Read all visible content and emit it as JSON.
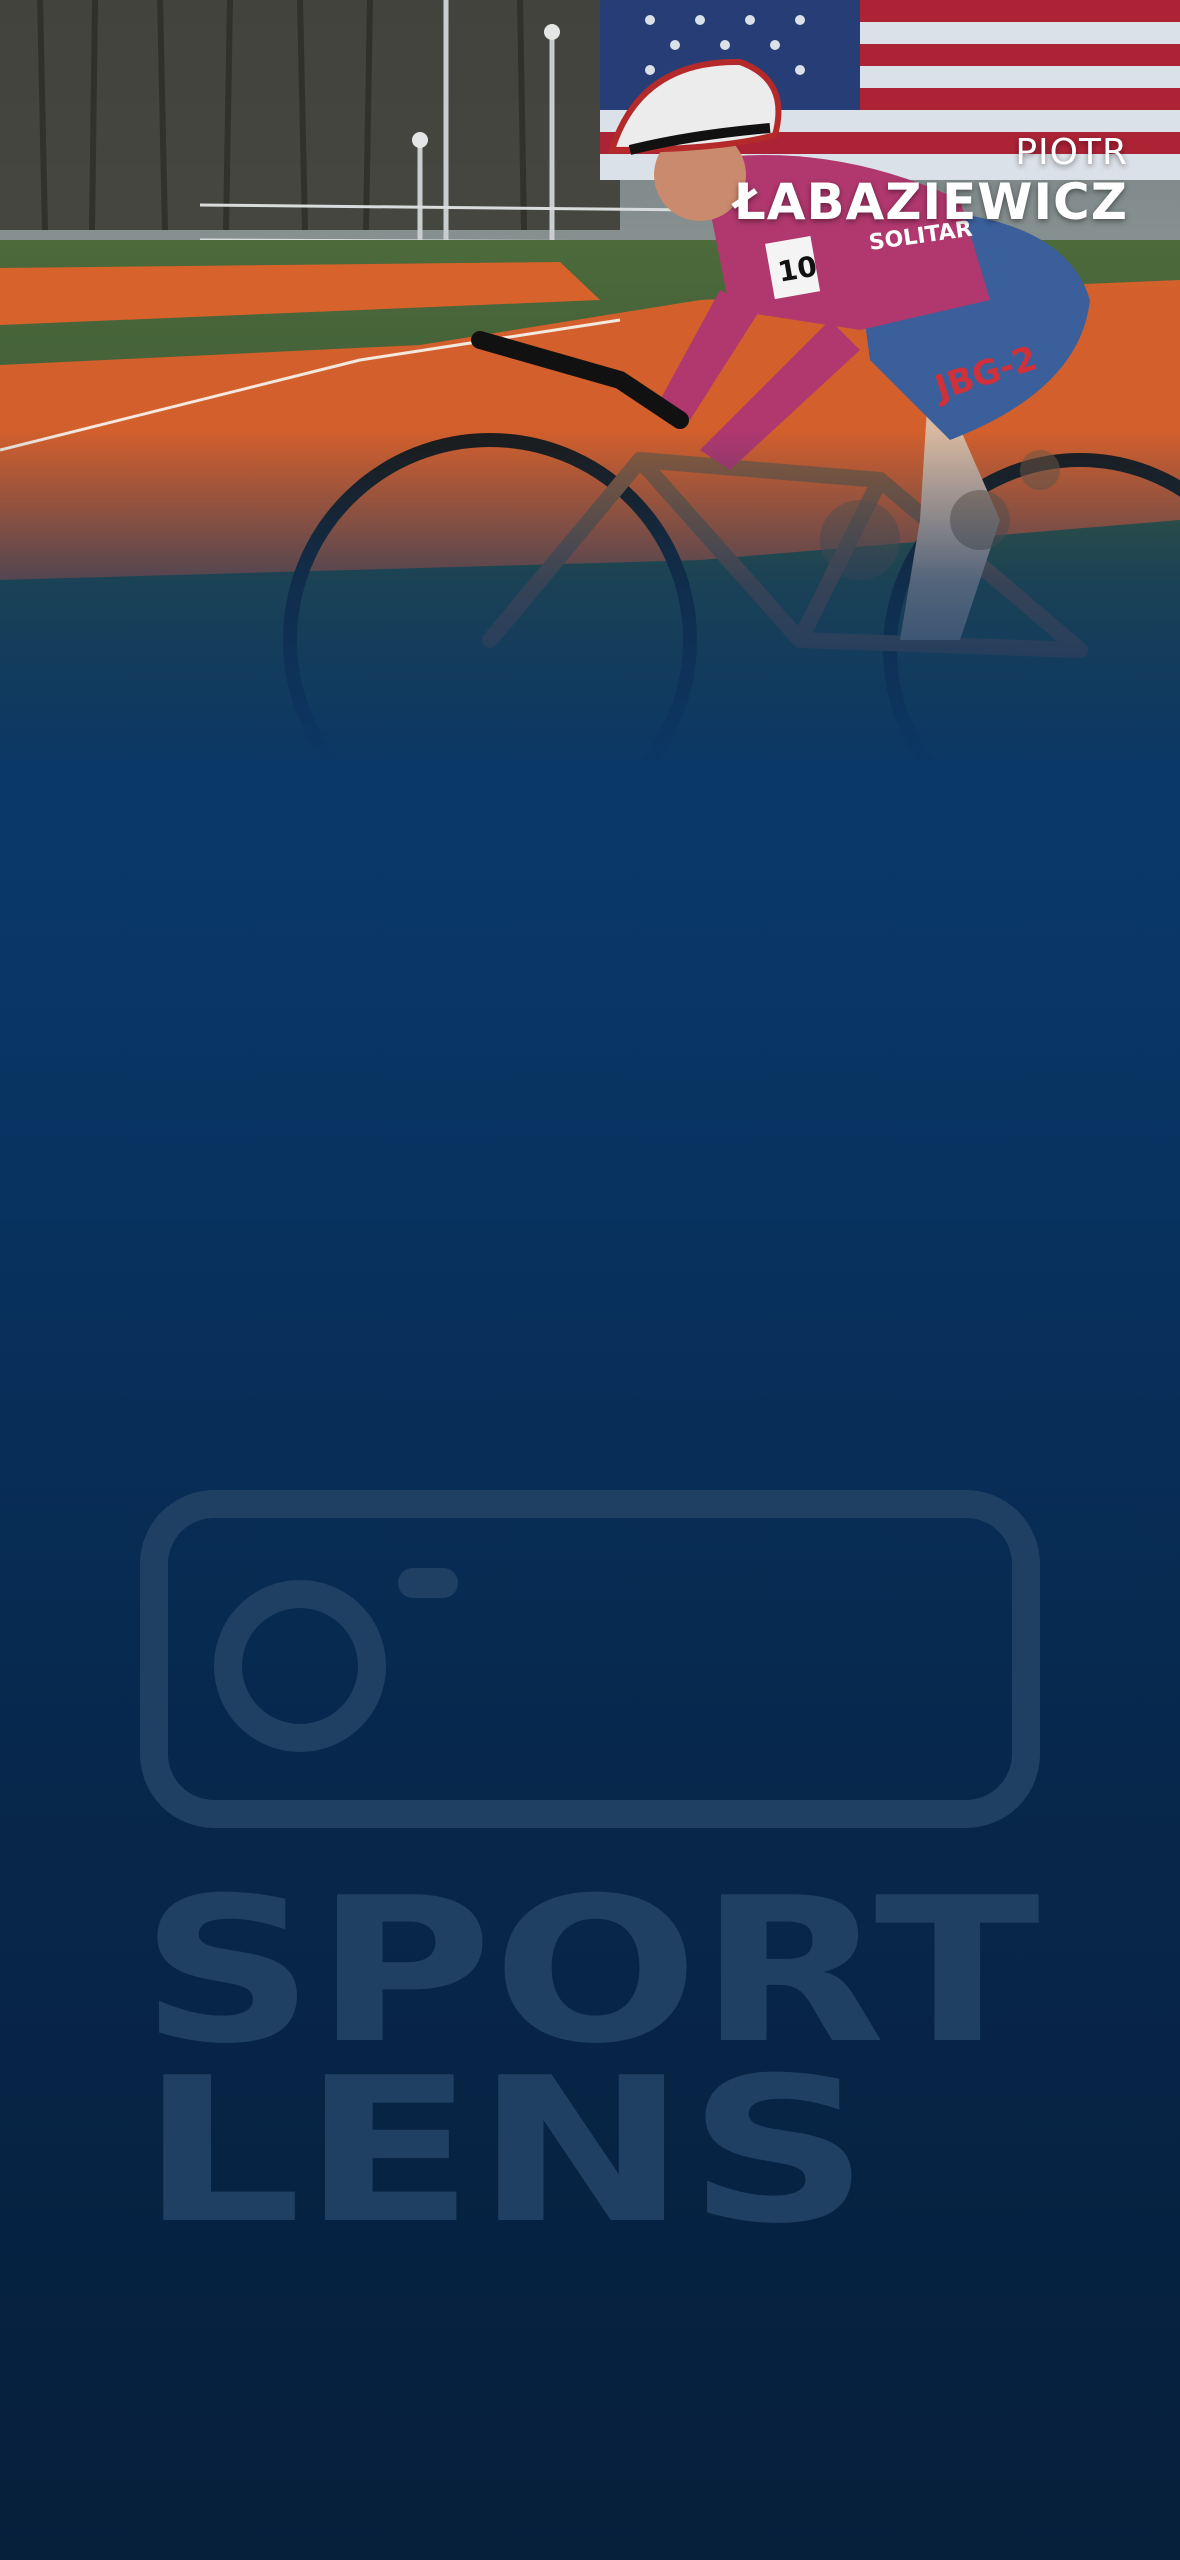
{
  "athlete": {
    "first_name": "PIOTR",
    "last_name": "ŁABAZIEWICZ"
  },
  "jersey": {
    "sponsor_main": "SOLITAR",
    "sponsor_shorts": "JBG-2",
    "bib_number": "10"
  },
  "brand": {
    "logo_line_1": "SPORT",
    "logo_line_2": "LENS"
  },
  "colors": {
    "background_top": "#0b3766",
    "background_bottom": "#061f3b",
    "watermark": "#1f4062",
    "name_text": "#ffffff",
    "barrier_orange": "#e8622b",
    "jersey_magenta": "#b0386e"
  },
  "icons": {
    "flag": "usa-flag-icon",
    "camera": "camera-outline-icon"
  }
}
